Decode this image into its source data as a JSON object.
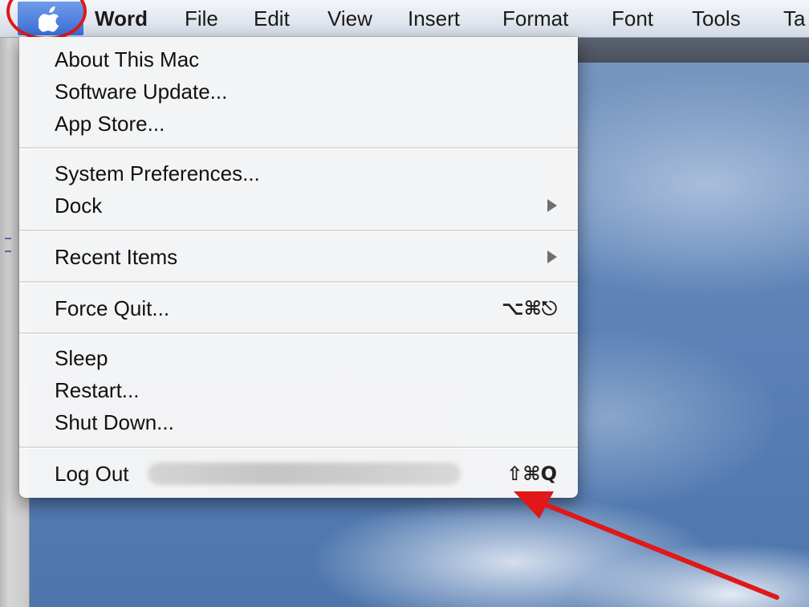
{
  "menubar": {
    "apple_icon": "apple-icon",
    "items": [
      "Word",
      "File",
      "Edit",
      "View",
      "Insert",
      "Format",
      "Font",
      "Tools",
      "Ta"
    ]
  },
  "apple_menu": {
    "group1": [
      "About This Mac",
      "Software Update...",
      "App Store..."
    ],
    "group2": [
      "System Preferences...",
      "Dock"
    ],
    "recent_items": "Recent Items",
    "force_quit": {
      "label": "Force Quit...",
      "shortcut": "⌥⌘⎋"
    },
    "group5": [
      "Sleep",
      "Restart...",
      "Shut Down..."
    ],
    "log_out": {
      "label": "Log Out",
      "shortcut": "⇧⌘Q"
    }
  },
  "colors": {
    "highlight_circle": "#e01818",
    "annotation_arrow": "#e01818",
    "apple_button": "#3b6fd8"
  }
}
